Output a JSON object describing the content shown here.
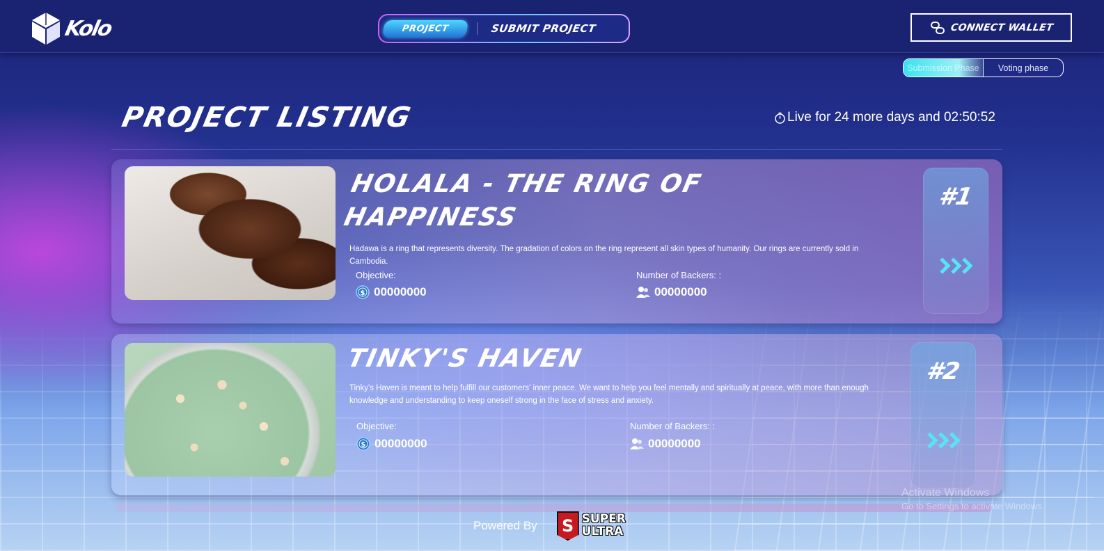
{
  "header": {
    "logo_text": "Kolo",
    "nav": {
      "project_label": "Project",
      "submit_label": "Submit Project"
    },
    "connect_wallet_label": "Connect Wallet"
  },
  "phase_toggle": {
    "submission_label": "Submission Phase",
    "voting_label": "Voting phase"
  },
  "page_title": "Project Listing",
  "countdown": "Live for 24 more days and 02:50:52",
  "projects": [
    {
      "title": "Holala - The Ring of Happiness",
      "description": "Hadawa is a ring that represents diversity. The gradation of colors on the ring represent all skin types of humanity. Our rings are currently sold in Cambodia.",
      "objective_label": "Objective:",
      "objective_value": "00000000",
      "backers_label": "Number of Backers: :",
      "backers_value": "00000000",
      "rank": "#1"
    },
    {
      "title": "Tinky's Haven",
      "description": "Tinky's Haven is meant to help fulfill our customers' inner peace. We want to help you feel mentally and spiritually at peace, with more than enough knowledge and understanding to keep oneself strong in the face of stress and anxiety.",
      "objective_label": "Objective:",
      "objective_value": "00000000",
      "backers_label": "Number of Backers: :",
      "backers_value": "00000000",
      "rank": "#2"
    }
  ],
  "footer": {
    "powered_by": "Powered By",
    "brand_line1": "SUPER",
    "brand_line2": "ULTRA",
    "brand_badge": "S"
  },
  "watermark": {
    "line1": "Activate Windows",
    "line2": "Go to Settings to activate Windows."
  },
  "colors": {
    "accent_cyan": "#4fd6ff",
    "nav_border_pink": "#d65cf0",
    "header_bg": "#1a2272"
  }
}
